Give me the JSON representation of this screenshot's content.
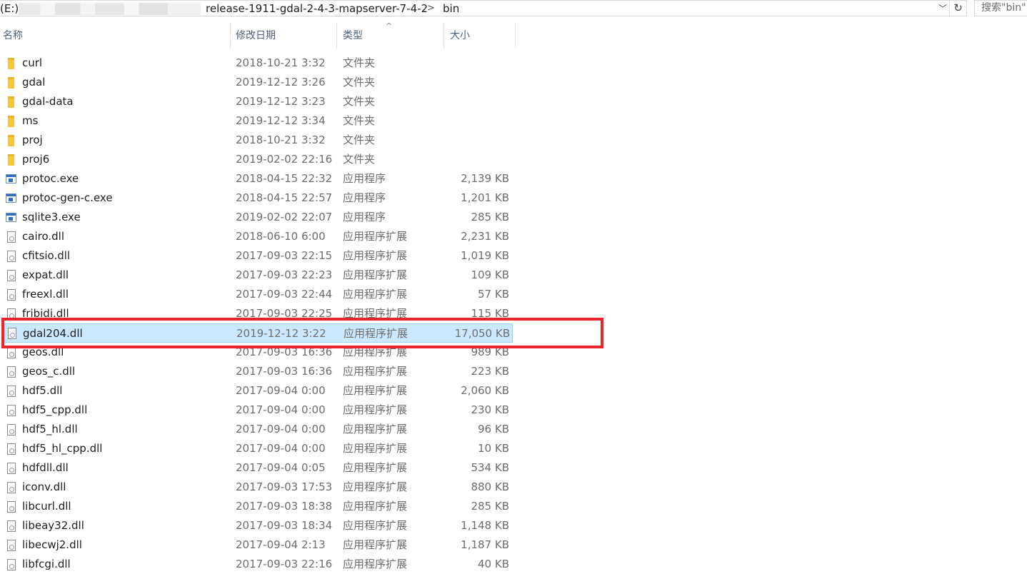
{
  "address_bar": {
    "drive": "(E:)",
    "segment1": "release-1911-gdal-2-4-3-mapserver-7-4-2",
    "separator": ">",
    "segment2": "bin",
    "dropdown": "﹀",
    "refresh": "↻"
  },
  "search": {
    "placeholder": "搜索\"bin\""
  },
  "columns": {
    "name": "名称",
    "date": "修改日期",
    "type": "类型",
    "size": "大小",
    "sort_caret": "^"
  },
  "files": [
    {
      "name": "curl",
      "date": "2018-10-21 3:32",
      "type": "文件夹",
      "size": "",
      "icon": "folder-icon"
    },
    {
      "name": "gdal",
      "date": "2019-12-12 3:26",
      "type": "文件夹",
      "size": "",
      "icon": "folder-icon"
    },
    {
      "name": "gdal-data",
      "date": "2019-12-12 3:23",
      "type": "文件夹",
      "size": "",
      "icon": "folder-icon"
    },
    {
      "name": "ms",
      "date": "2019-12-12 3:34",
      "type": "文件夹",
      "size": "",
      "icon": "folder-icon"
    },
    {
      "name": "proj",
      "date": "2018-10-21 3:32",
      "type": "文件夹",
      "size": "",
      "icon": "folder-icon"
    },
    {
      "name": "proj6",
      "date": "2019-02-02 22:16",
      "type": "文件夹",
      "size": "",
      "icon": "folder-icon"
    },
    {
      "name": "protoc.exe",
      "date": "2018-04-15 22:32",
      "type": "应用程序",
      "size": "2,139 KB",
      "icon": "exe-icon"
    },
    {
      "name": "protoc-gen-c.exe",
      "date": "2018-04-15 22:57",
      "type": "应用程序",
      "size": "1,201 KB",
      "icon": "exe-icon"
    },
    {
      "name": "sqlite3.exe",
      "date": "2019-02-02 22:07",
      "type": "应用程序",
      "size": "285 KB",
      "icon": "exe-icon"
    },
    {
      "name": "cairo.dll",
      "date": "2018-06-10 6:00",
      "type": "应用程序扩展",
      "size": "2,231 KB",
      "icon": "dll-icon"
    },
    {
      "name": "cfitsio.dll",
      "date": "2017-09-03 22:15",
      "type": "应用程序扩展",
      "size": "1,019 KB",
      "icon": "dll-icon"
    },
    {
      "name": "expat.dll",
      "date": "2017-09-03 22:23",
      "type": "应用程序扩展",
      "size": "109 KB",
      "icon": "dll-icon"
    },
    {
      "name": "freexl.dll",
      "date": "2017-09-03 22:44",
      "type": "应用程序扩展",
      "size": "57 KB",
      "icon": "dll-icon"
    },
    {
      "name": "fribidi.dll",
      "date": "2017-09-03 22:25",
      "type": "应用程序扩展",
      "size": "115 KB",
      "icon": "dll-icon"
    },
    {
      "name": "gdal204.dll",
      "date": "2019-12-12 3:22",
      "type": "应用程序扩展",
      "size": "17,050 KB",
      "icon": "dll-icon",
      "selected": true
    },
    {
      "name": "geos.dll",
      "date": "2017-09-03 16:36",
      "type": "应用程序扩展",
      "size": "989 KB",
      "icon": "dll-icon"
    },
    {
      "name": "geos_c.dll",
      "date": "2017-09-03 16:36",
      "type": "应用程序扩展",
      "size": "223 KB",
      "icon": "dll-icon"
    },
    {
      "name": "hdf5.dll",
      "date": "2017-09-04 0:00",
      "type": "应用程序扩展",
      "size": "2,060 KB",
      "icon": "dll-icon"
    },
    {
      "name": "hdf5_cpp.dll",
      "date": "2017-09-04 0:00",
      "type": "应用程序扩展",
      "size": "230 KB",
      "icon": "dll-icon"
    },
    {
      "name": "hdf5_hl.dll",
      "date": "2017-09-04 0:00",
      "type": "应用程序扩展",
      "size": "96 KB",
      "icon": "dll-icon"
    },
    {
      "name": "hdf5_hl_cpp.dll",
      "date": "2017-09-04 0:00",
      "type": "应用程序扩展",
      "size": "10 KB",
      "icon": "dll-icon"
    },
    {
      "name": "hdfdll.dll",
      "date": "2017-09-04 0:05",
      "type": "应用程序扩展",
      "size": "534 KB",
      "icon": "dll-icon"
    },
    {
      "name": "iconv.dll",
      "date": "2017-09-03 17:53",
      "type": "应用程序扩展",
      "size": "880 KB",
      "icon": "dll-icon"
    },
    {
      "name": "libcurl.dll",
      "date": "2017-09-03 18:38",
      "type": "应用程序扩展",
      "size": "285 KB",
      "icon": "dll-icon"
    },
    {
      "name": "libeay32.dll",
      "date": "2017-09-03 18:34",
      "type": "应用程序扩展",
      "size": "1,148 KB",
      "icon": "dll-icon"
    },
    {
      "name": "libecwj2.dll",
      "date": "2017-09-04 2:13",
      "type": "应用程序扩展",
      "size": "1,187 KB",
      "icon": "dll-icon"
    },
    {
      "name": "libfcgi.dll",
      "date": "2017-09-03 22:16",
      "type": "应用程序扩展",
      "size": "40 KB",
      "icon": "dll-icon"
    }
  ],
  "colors": {
    "selection_bg": "#cce8ff",
    "selection_border": "#99d1ff",
    "annotation_red": "#e8262b",
    "folder_yellow": "#f5c542"
  }
}
